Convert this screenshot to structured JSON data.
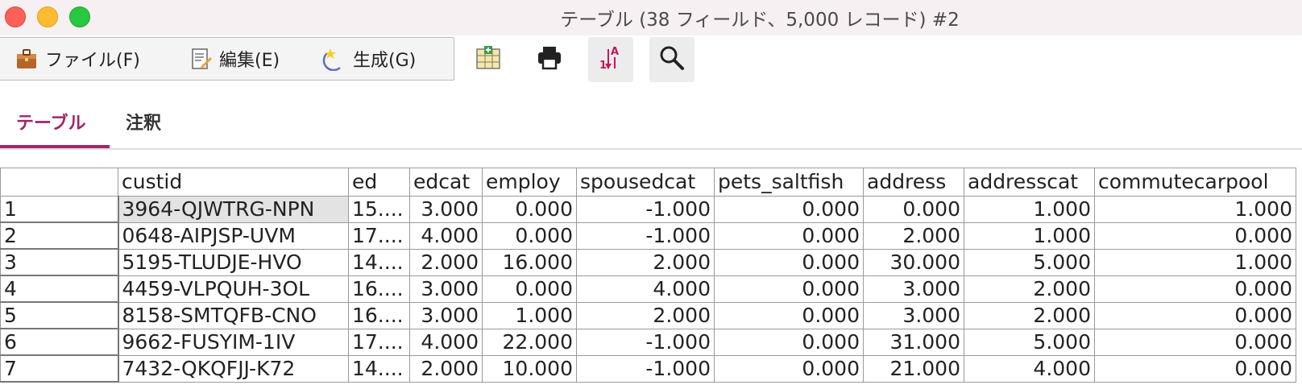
{
  "window": {
    "title": "テーブル (38 フィールド、5,000 レコード) #2"
  },
  "menu": {
    "file": "ファイル(F)",
    "edit": "編集(E)",
    "generate": "生成(G)"
  },
  "toolbar_icons": [
    "add-table-icon",
    "print-icon",
    "sort-icon",
    "search-icon"
  ],
  "tabs": {
    "table": "テーブル",
    "annotation": "注釈"
  },
  "colors": {
    "accent": "#a3256b",
    "selected_cell": "#e3e3e3"
  },
  "grid": {
    "columns": [
      "",
      "custid",
      "ed",
      "edcat",
      "employ",
      "spousedcat",
      "pets_saltfish",
      "address",
      "addresscat",
      "commutecarpool"
    ],
    "rows": [
      [
        "1",
        "3964-QJWTRG-NPN",
        "15....",
        "3.000",
        "0.000",
        "-1.000",
        "0.000",
        "0.000",
        "1.000",
        "1.000"
      ],
      [
        "2",
        "0648-AIPJSP-UVM",
        "17....",
        "4.000",
        "0.000",
        "-1.000",
        "0.000",
        "2.000",
        "1.000",
        "0.000"
      ],
      [
        "3",
        "5195-TLUDJE-HVO",
        "14....",
        "2.000",
        "16.000",
        "2.000",
        "0.000",
        "30.000",
        "5.000",
        "1.000"
      ],
      [
        "4",
        "4459-VLPQUH-3OL",
        "16....",
        "3.000",
        "0.000",
        "4.000",
        "0.000",
        "3.000",
        "2.000",
        "0.000"
      ],
      [
        "5",
        "8158-SMTQFB-CNO",
        "16....",
        "3.000",
        "1.000",
        "2.000",
        "0.000",
        "3.000",
        "2.000",
        "0.000"
      ],
      [
        "6",
        "9662-FUSYIM-1IV",
        "17....",
        "4.000",
        "22.000",
        "-1.000",
        "0.000",
        "31.000",
        "5.000",
        "0.000"
      ],
      [
        "7",
        "7432-QKQFJJ-K72",
        "14....",
        "2.000",
        "10.000",
        "-1.000",
        "0.000",
        "21.000",
        "4.000",
        "0.000"
      ]
    ]
  }
}
